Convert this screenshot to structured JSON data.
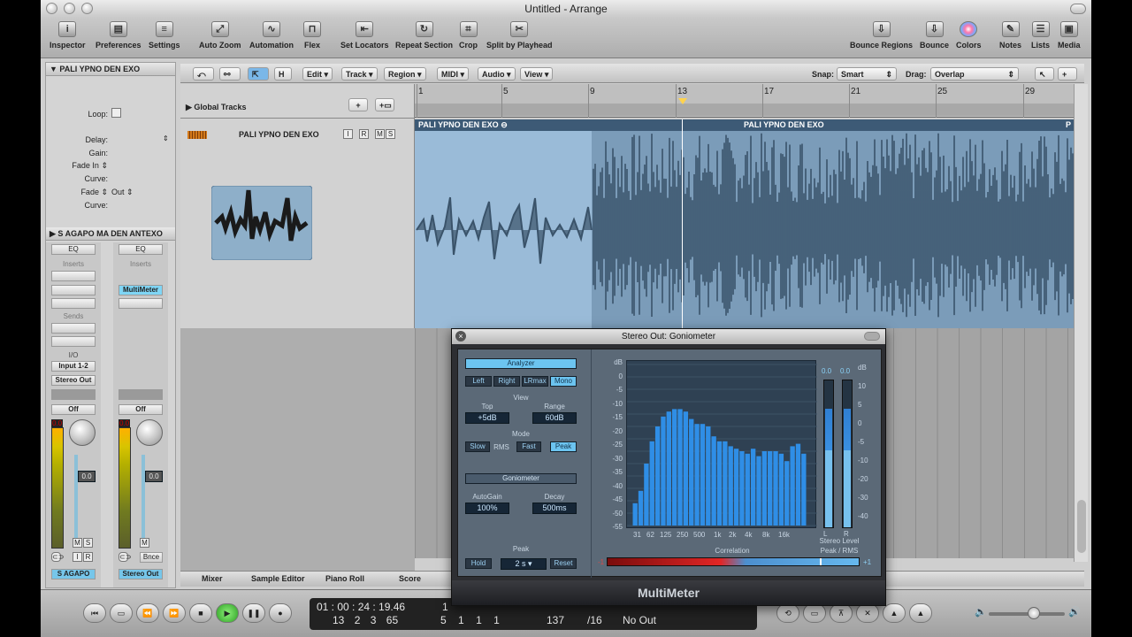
{
  "window": {
    "title": "Untitled - Arrange"
  },
  "toolbar": {
    "items": [
      {
        "label": "Inspector",
        "icon": "info-icon"
      },
      {
        "label": "Preferences",
        "icon": "preferences-icon"
      },
      {
        "label": "Settings",
        "icon": "settings-icon"
      },
      {
        "label": "Auto Zoom",
        "icon": "zoom-icon"
      },
      {
        "label": "Automation",
        "icon": "automation-icon"
      },
      {
        "label": "Flex",
        "icon": "flex-icon"
      },
      {
        "label": "Set Locators",
        "icon": "locators-icon"
      },
      {
        "label": "Repeat Section",
        "icon": "repeat-icon"
      },
      {
        "label": "Crop",
        "icon": "crop-icon"
      },
      {
        "label": "Split by Playhead",
        "icon": "split-icon"
      },
      {
        "label": "Bounce Regions",
        "icon": "bounce-regions-icon"
      },
      {
        "label": "Bounce",
        "icon": "bounce-icon"
      },
      {
        "label": "Colors",
        "icon": "colors-icon"
      },
      {
        "label": "Notes",
        "icon": "notes-icon"
      },
      {
        "label": "Lists",
        "icon": "lists-icon"
      },
      {
        "label": "Media",
        "icon": "media-icon"
      }
    ]
  },
  "inspector": {
    "region_header": "PALI YPNO DEN EXO",
    "params": [
      "Loop:",
      "Delay:",
      "Gain:",
      "Fade In",
      "Curve:",
      "Fade",
      "Out",
      "Curve:"
    ],
    "track_header": "S AGAPO MA DEN ANTEXO",
    "strip1": {
      "eq": "EQ",
      "inserts": "Inserts",
      "sends": "Sends",
      "io": "I/O",
      "input": "Input 1-2",
      "output": "Stereo Out",
      "auto": "Off",
      "value": "0.0",
      "peak": "0.0",
      "name": "S AGAPO",
      "m": "M",
      "s": "S",
      "i": "I",
      "r": "R"
    },
    "strip2": {
      "eq": "EQ",
      "inserts": "Inserts",
      "insert1": "MultiMeter",
      "auto": "Off",
      "value": "0.0",
      "peak": "0.0",
      "name": "Stereo Out",
      "m": "M",
      "bnce": "Bnce"
    }
  },
  "arrange_toolbar": {
    "menus": [
      "Edit",
      "Track",
      "Region",
      "MIDI",
      "Audio",
      "View"
    ],
    "snap_label": "Snap:",
    "snap_value": "Smart",
    "drag_label": "Drag:",
    "drag_value": "Overlap",
    "h_btn": "H"
  },
  "tracks": {
    "global_tracks": "Global Tracks",
    "track_name": "PALI YPNO DEN EXO",
    "btns": [
      "I",
      "R",
      "M",
      "S"
    ]
  },
  "ruler": {
    "bars": [
      "1",
      "5",
      "9",
      "13",
      "17",
      "21",
      "25",
      "29"
    ]
  },
  "regions": [
    "PALI YPNO DEN EXO",
    "PALI YPNO DEN EXO",
    "P"
  ],
  "bottom_tabs": [
    "Mixer",
    "Sample Editor",
    "Piano Roll",
    "Score"
  ],
  "transport": {
    "time_top": "01 : 00 : 24 : 19.46",
    "bars_bottom": [
      "13",
      "2",
      "3",
      "65"
    ],
    "pos_top": "1",
    "pos_bottom": [
      "5",
      "1",
      "1",
      "1"
    ],
    "tempo": "137",
    "sig": "/16",
    "output": "No Out"
  },
  "plugin": {
    "title": "Stereo Out: Goniometer",
    "analyzer": "Analyzer",
    "channels": [
      "Left",
      "Right",
      "LRmax",
      "Mono"
    ],
    "view": "View",
    "top_label": "Top",
    "top_value": "+5dB",
    "range_label": "Range",
    "range_value": "60dB",
    "mode": "Mode",
    "modes": [
      "Slow",
      "RMS",
      "Fast",
      "Peak"
    ],
    "goniometer": "Goniometer",
    "autogain_label": "AutoGain",
    "autogain_value": "100%",
    "decay_label": "Decay",
    "decay_value": "500ms",
    "peak_label": "Peak",
    "hold": "Hold",
    "hold_value": "2 s",
    "reset": "Reset",
    "db_axis": [
      "dB",
      "0",
      "-5",
      "-10",
      "-15",
      "-20",
      "-25",
      "-30",
      "-35",
      "-40",
      "-45",
      "-50",
      "-55"
    ],
    "freq_axis": [
      "31",
      "62",
      "125",
      "250",
      "500",
      "1k",
      "2k",
      "4k",
      "8k",
      "16k"
    ],
    "level_left": "0.0",
    "level_right": "0.0",
    "level_axis": [
      "dB",
      "10",
      "5",
      "0",
      "-5",
      "-10",
      "-20",
      "-30",
      "-40"
    ],
    "lr": [
      "L",
      "R"
    ],
    "stereo_level": "Stereo Level",
    "peak_rms": "Peak / RMS",
    "correlation": "Correlation",
    "corr_min": "-1",
    "corr_max": "+1",
    "footer": "MultiMeter"
  },
  "chart_data": {
    "type": "bar",
    "title": "",
    "xlabel": "",
    "ylabel": "dB",
    "ylim": [
      -60,
      5
    ],
    "bands": 31,
    "values": [
      -51,
      -46,
      -35,
      -26,
      -20,
      -16,
      -14,
      -13,
      -13,
      -14,
      -17,
      -19,
      -19,
      -20,
      -24,
      -26,
      -26,
      -28,
      -29,
      -30,
      -31,
      -29,
      -32,
      -30,
      -30,
      -30,
      -31,
      -34,
      -28,
      -27,
      -31
    ]
  }
}
